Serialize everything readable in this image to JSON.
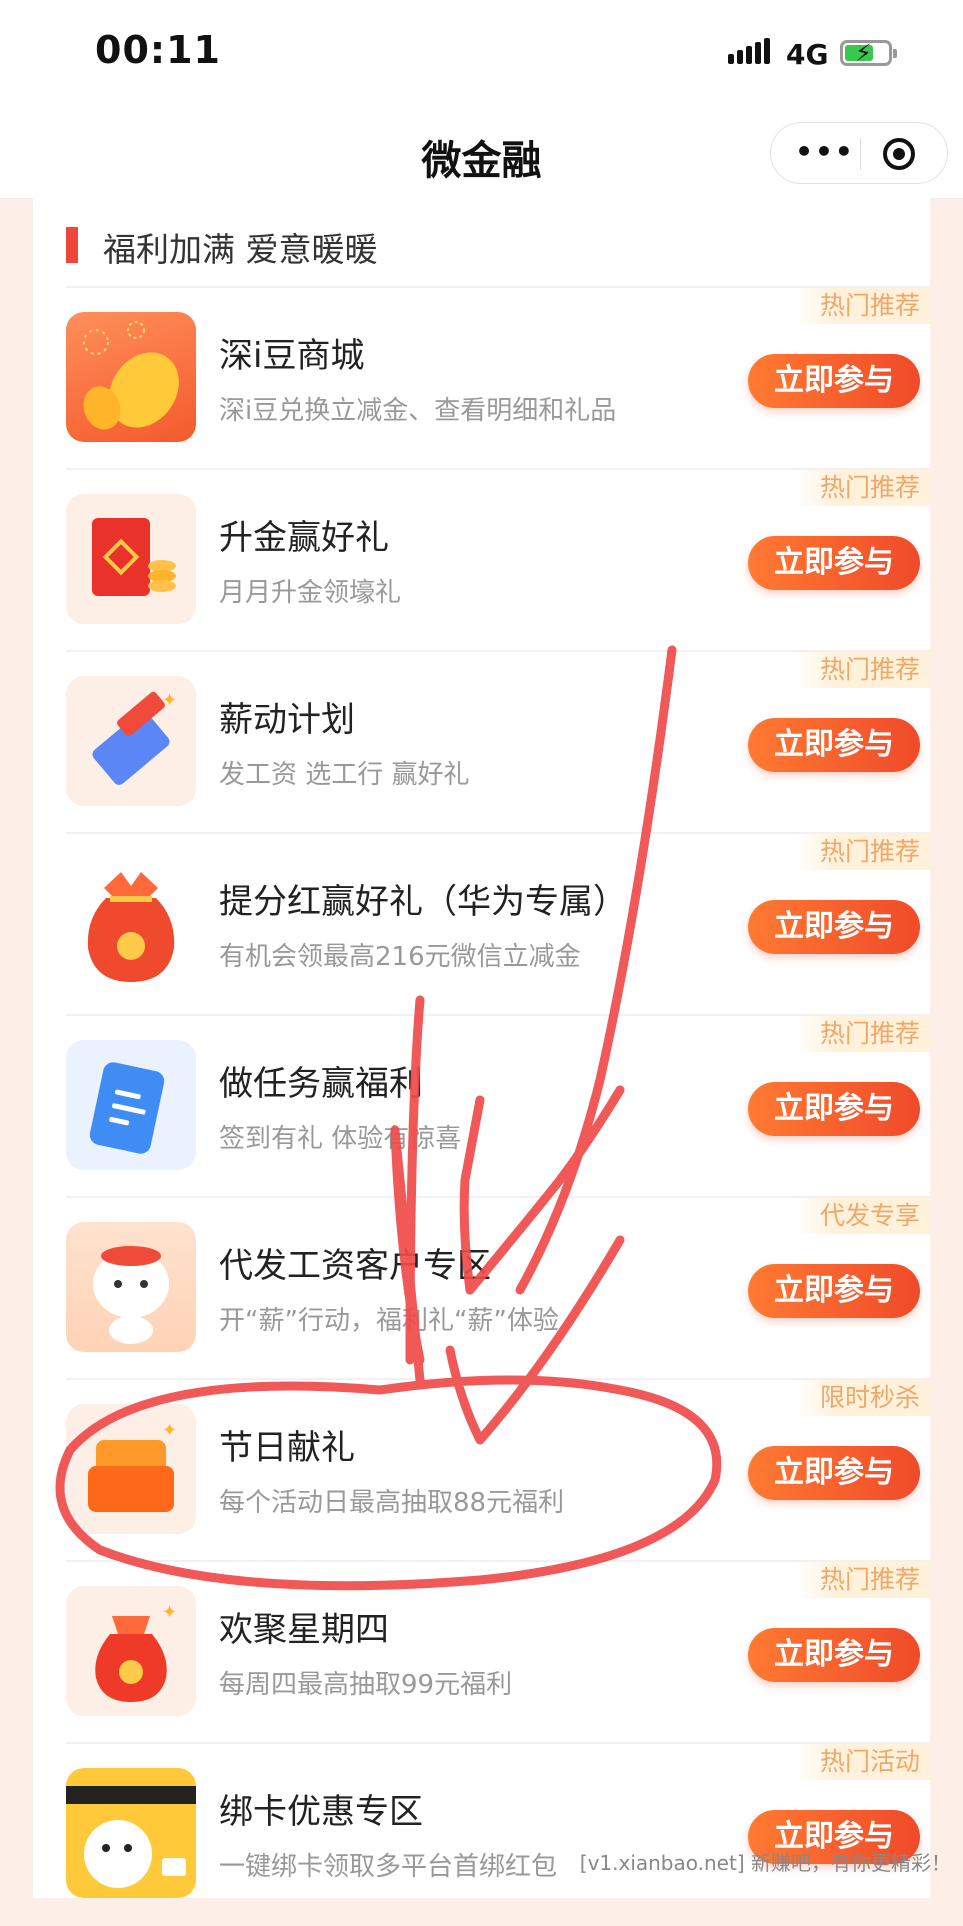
{
  "status_bar": {
    "time": "00:11",
    "network": "4G",
    "battery_color": "#37c84f"
  },
  "nav": {
    "title": "微金融",
    "more": "•••"
  },
  "section": {
    "title": "福利加满 爱意暖暖",
    "accent_color": "#f0453b"
  },
  "join_label": "立即参与",
  "items": [
    {
      "tag": "热门推荐",
      "name": "深i豆商城",
      "desc": "深i豆兑换立减金、查看明细和礼品",
      "icon": "golden-bean-icon"
    },
    {
      "tag": "热门推荐",
      "name": "升金赢好礼",
      "desc": "月月升金领壕礼",
      "icon": "red-envelope-coins-icon"
    },
    {
      "tag": "热门推荐",
      "name": "薪动计划",
      "desc": "发工资 选工行 赢好礼",
      "icon": "bank-card-icon"
    },
    {
      "tag": "热门推荐",
      "name": "提分红赢好礼（华为专属）",
      "desc": "有机会领最高216元微信立减金",
      "icon": "lucky-bag-icon"
    },
    {
      "tag": "热门推荐",
      "name": "做任务赢福利",
      "desc": "签到有礼 体验有惊喜",
      "icon": "task-clipboard-icon"
    },
    {
      "tag": "代发专享",
      "name": "代发工资客户专区",
      "desc": "开“薪”行动，福利礼“薪”体验",
      "icon": "mascot-icon"
    },
    {
      "tag": "限时秒杀",
      "name": "节日献礼",
      "desc": "每个活动日最高抽取88元福利",
      "icon": "gift-box-icon"
    },
    {
      "tag": "热门推荐",
      "name": "欢聚星期四",
      "desc": "每周四最高抽取99元福利",
      "icon": "money-bag-icon"
    },
    {
      "tag": "热门活动",
      "name": "绑卡优惠专区",
      "desc": "一键绑卡领取多平台首绑红包",
      "icon": "dog-card-icon"
    }
  ],
  "watermark": "[v1.xianbao.net] 新赚吧，有你更精彩！"
}
